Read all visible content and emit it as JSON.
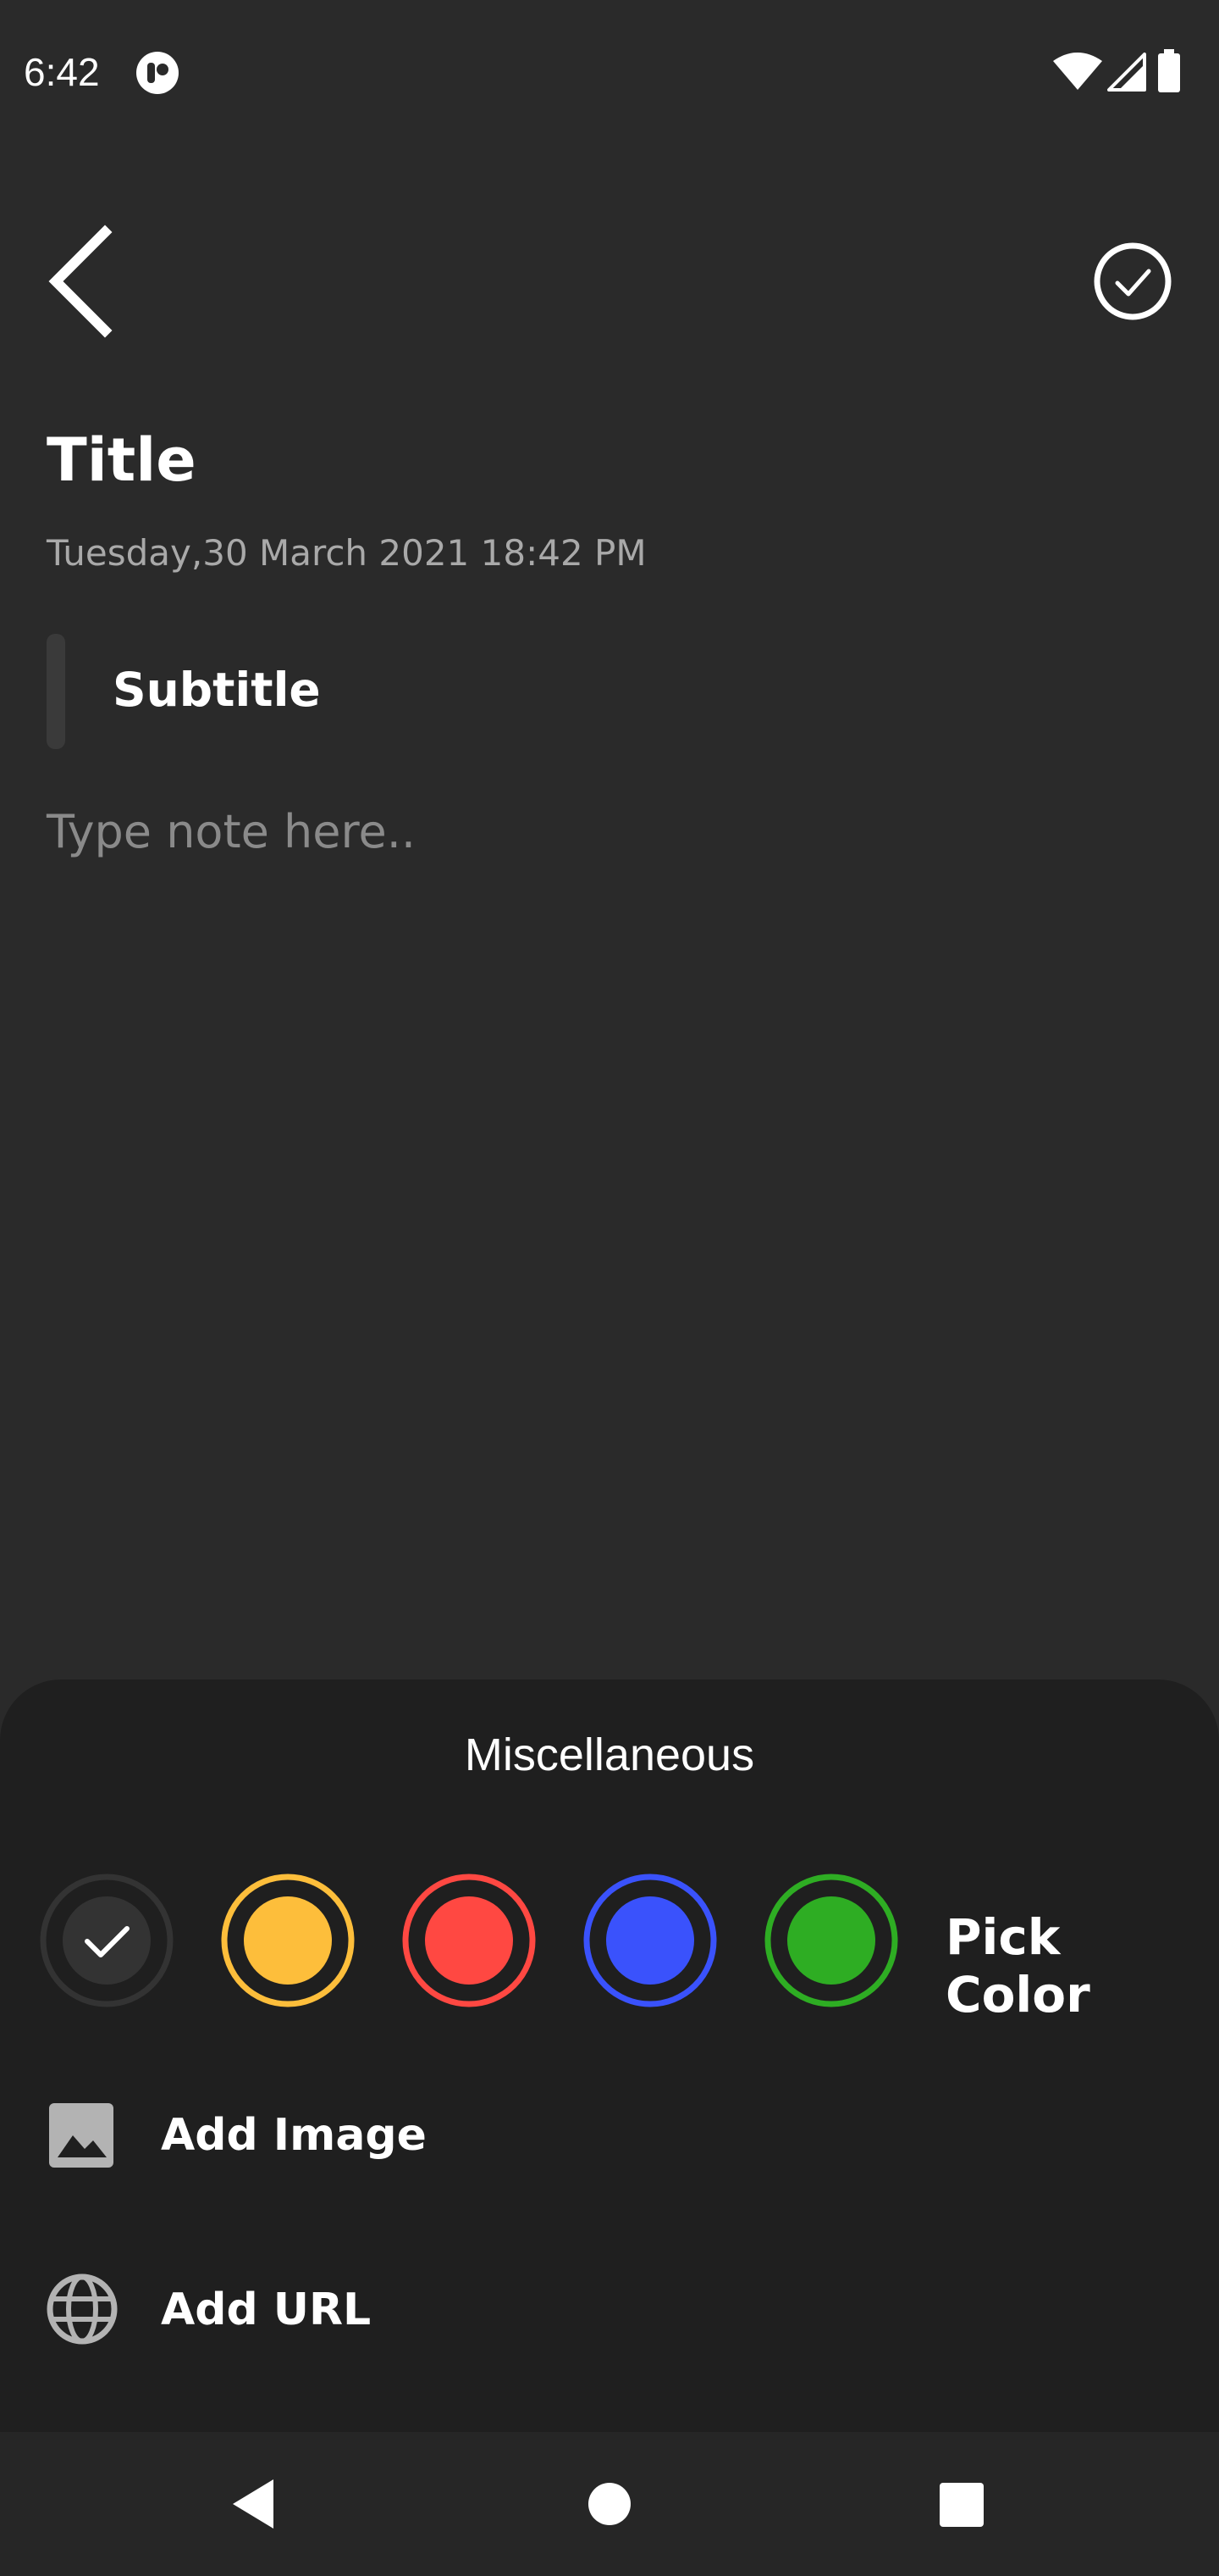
{
  "status_bar": {
    "time": "6:42",
    "app_icon": "app-notification-icon",
    "icons": [
      "wifi-icon",
      "cellular-signal-icon",
      "battery-icon"
    ]
  },
  "header": {
    "back_icon": "chevron-left-icon",
    "save_icon": "check-circle-icon"
  },
  "note": {
    "title": "Title",
    "datetime": "Tuesday,30 March 2021 18:42 PM",
    "subtitle": "Subtitle",
    "body_placeholder": "Type note here.."
  },
  "sheet": {
    "title": "Miscellaneous",
    "colors": [
      {
        "name": "default",
        "hex": "#333333",
        "selected": true
      },
      {
        "name": "yellow",
        "hex": "#FDBE3B",
        "selected": false
      },
      {
        "name": "red",
        "hex": "#FF4842",
        "selected": false
      },
      {
        "name": "blue",
        "hex": "#3A52FC",
        "selected": false
      },
      {
        "name": "green",
        "hex": "#2EAD23",
        "selected": false
      }
    ],
    "pick_color_label": "Pick Color",
    "add_image_label": "Add Image",
    "add_url_label": "Add URL"
  },
  "nav_bar": {
    "icons": [
      "back-triangle-icon",
      "home-circle-icon",
      "recents-square-icon"
    ]
  }
}
